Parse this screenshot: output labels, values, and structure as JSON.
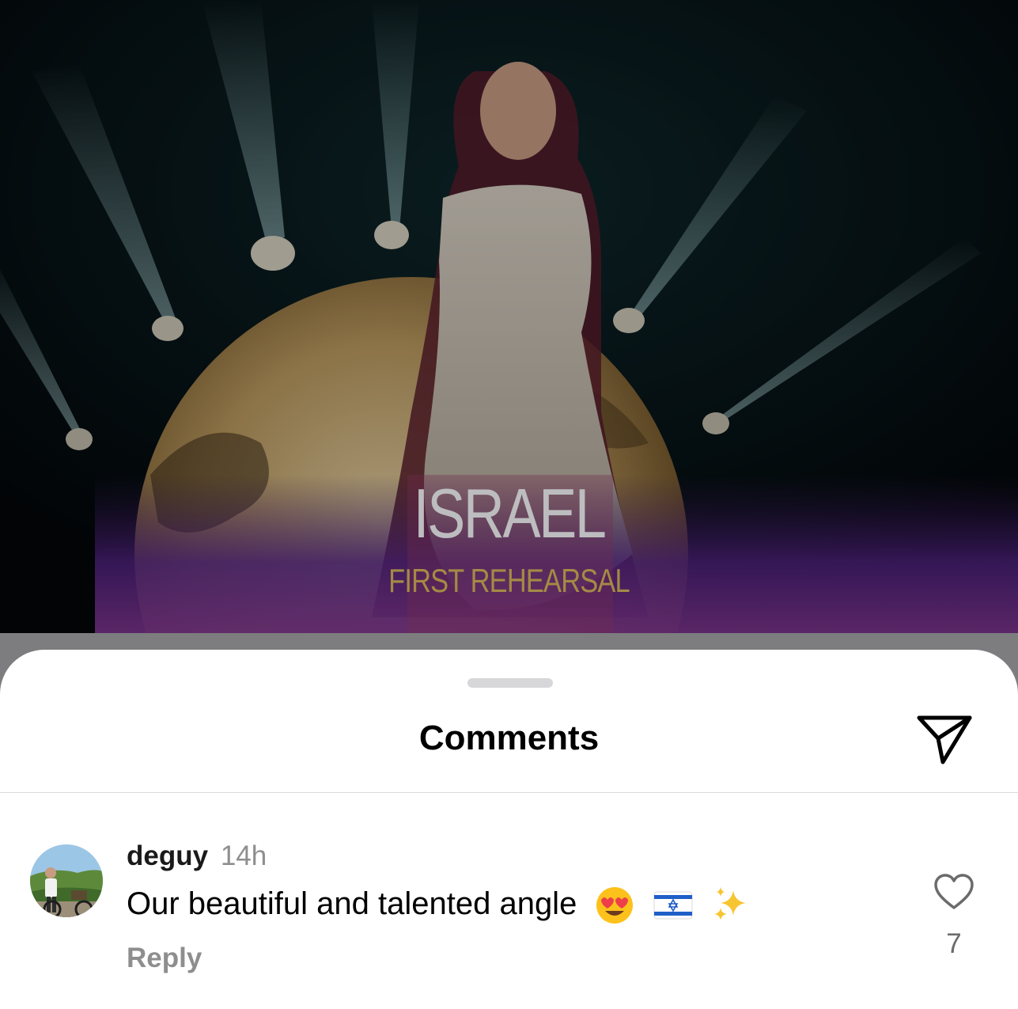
{
  "post": {
    "overlay_title": "ISRAEL",
    "overlay_subtitle": "FIRST REHEARSAL"
  },
  "sheet": {
    "title": "Comments",
    "share_icon": "paper-plane-icon"
  },
  "comments": [
    {
      "username": "deguy",
      "timestamp": "14h",
      "text": "Our beautiful and talented angle",
      "emojis": [
        "heart-eyes-emoji",
        "israel-flag-emoji",
        "sparkles-emoji"
      ],
      "reply_label": "Reply",
      "like_icon": "heart-outline-icon",
      "like_count": "7"
    }
  ],
  "colors": {
    "sheet_background": "#ffffff",
    "secondary_text": "#8e8e8e",
    "overlay_title": "#bdbdbf",
    "overlay_subtitle": "#a48a45"
  }
}
